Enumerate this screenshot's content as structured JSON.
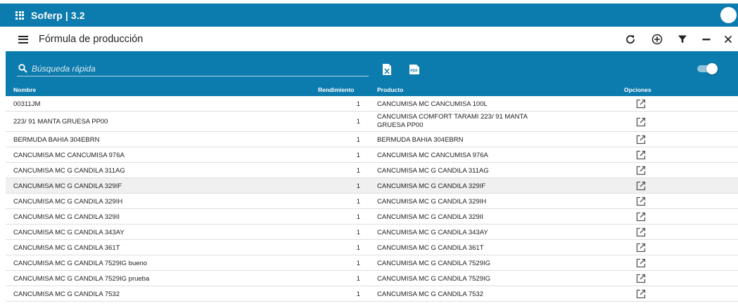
{
  "app": {
    "title": "Soferp | 3.2"
  },
  "toolbar": {
    "page_title": "Fórmula de producción",
    "icons": [
      "refresh-icon",
      "add-circle-icon",
      "filter-icon",
      "minimize-icon",
      "close-icon"
    ]
  },
  "panel": {
    "search_placeholder": "Búsqueda rápida",
    "export_excel_icon": "excel-export-icon",
    "export_pdf_icon": "pdf-export-icon",
    "toggle_on": true
  },
  "table": {
    "columns": {
      "nombre": "Nombre",
      "rendimiento": "Rendimiento",
      "producto": "Producto",
      "opciones": "Opciones"
    },
    "rows": [
      {
        "nombre": "00311JM",
        "rendimiento": "1",
        "producto": "CANCUMISA MC CANCUMISA 100L"
      },
      {
        "nombre": "223/ 91 MANTA GRUESA PP00",
        "rendimiento": "1",
        "producto": "CANCUMISA COMFORT TARAMI 223/ 91 MANTA GRUESA PP00"
      },
      {
        "nombre": "BERMUDA BAHIA 304EBRN",
        "rendimiento": "1",
        "producto": "BERMUDA BAHIA 304EBRN"
      },
      {
        "nombre": "CANCUMISA MC CANCUMISA 976A",
        "rendimiento": "1",
        "producto": "CANCUMISA MC CANCUMISA 976A"
      },
      {
        "nombre": "CANCUMISA MC G CANDILA 311AG",
        "rendimiento": "1",
        "producto": "CANCUMISA MC G CANDILA 311AG"
      },
      {
        "nombre": "CANCUMISA MC G CANDILA 329IF",
        "rendimiento": "1",
        "producto": "CANCUMISA MC G CANDILA 329IF"
      },
      {
        "nombre": "CANCUMISA MC G CANDILA 329IH",
        "rendimiento": "1",
        "producto": "CANCUMISA MC G CANDILA 329IH"
      },
      {
        "nombre": "CANCUMISA MC G CANDILA 329II",
        "rendimiento": "1",
        "producto": "CANCUMISA MC G CANDILA 329II"
      },
      {
        "nombre": "CANCUMISA MC G CANDILA 343AY",
        "rendimiento": "1",
        "producto": "CANCUMISA MC G CANDILA 343AY"
      },
      {
        "nombre": "CANCUMISA MC G CANDILA 361T",
        "rendimiento": "1",
        "producto": "CANCUMISA MC G CANDILA 361T"
      },
      {
        "nombre": "CANCUMISA MC G CANDILA 7529IG bueno",
        "rendimiento": "1",
        "producto": "CANCUMISA MC G CANDILA 7529IG"
      },
      {
        "nombre": "CANCUMISA MC G CANDILA 7529IG prueba",
        "rendimiento": "1",
        "producto": "CANCUMISA MC G CANDILA 7529IG"
      },
      {
        "nombre": "CANCUMISA MC G CANDILA 7532",
        "rendimiento": "1",
        "producto": "CANCUMISA MC G CANDILA 7532"
      }
    ],
    "highlighted_row": 5
  },
  "colors": {
    "primary": "#0c7bad",
    "row_highlight": "#f0f0f0",
    "divider": "#dedede"
  }
}
